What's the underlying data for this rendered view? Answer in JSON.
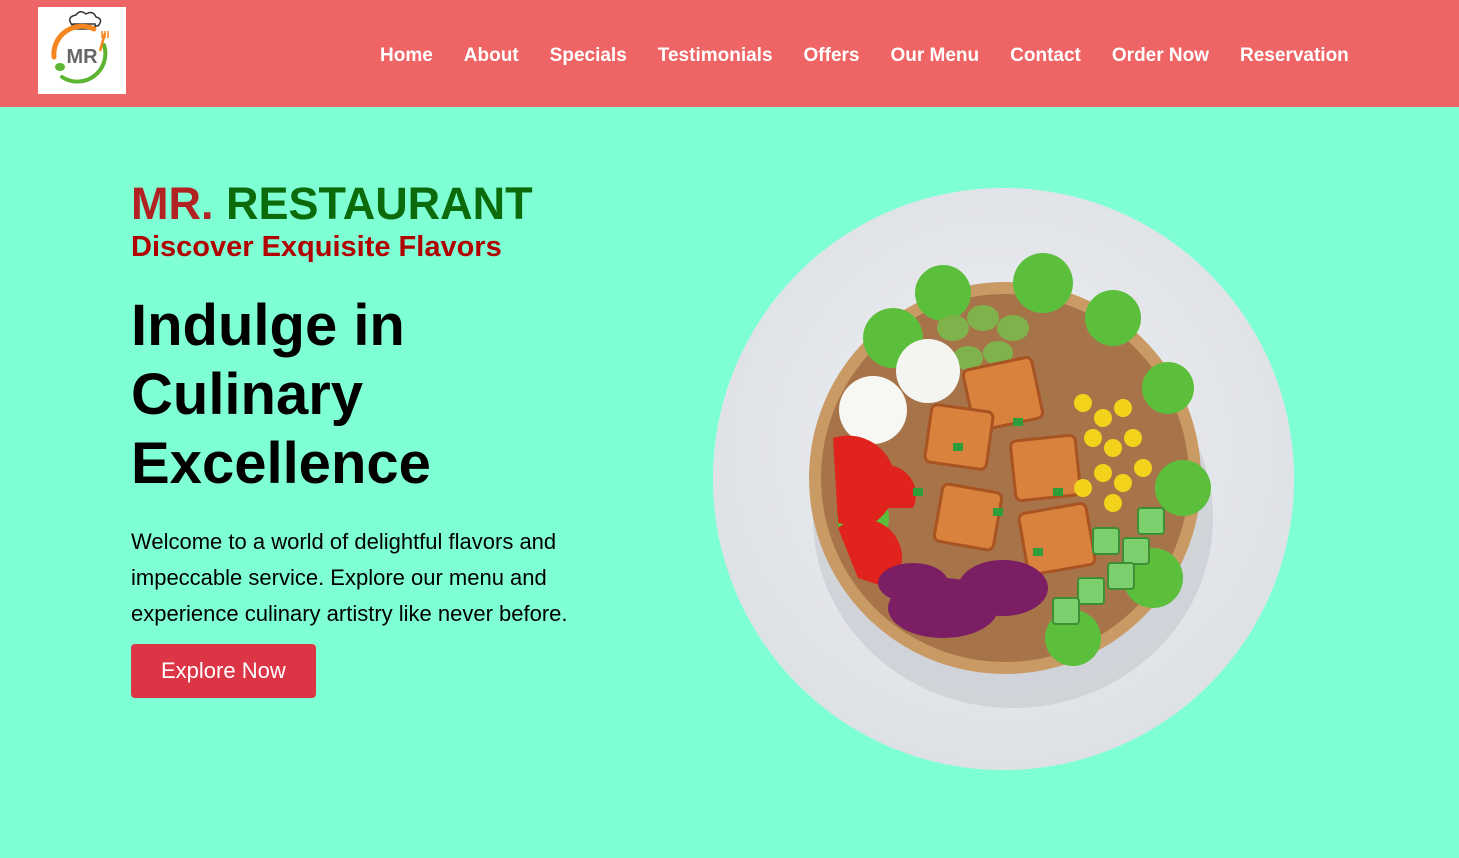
{
  "brand": {
    "logo_text": "MR",
    "logo_alt": "MR Restaurant logo"
  },
  "nav": {
    "items": [
      {
        "label": "Home"
      },
      {
        "label": "About"
      },
      {
        "label": "Specials"
      },
      {
        "label": "Testimonials"
      },
      {
        "label": "Offers"
      },
      {
        "label": "Our Menu"
      },
      {
        "label": "Contact"
      },
      {
        "label": "Order Now"
      },
      {
        "label": "Reservation"
      }
    ]
  },
  "hero": {
    "brand_first": "MR.",
    "brand_second": "RESTAURANT",
    "tagline": "Discover Exquisite Flavors",
    "headline": "Indulge in Culinary Excellence",
    "description": "Welcome to a world of delightful flavors and impeccable service. Explore our menu and experience culinary artistry like never before.",
    "cta_label": "Explore Now",
    "image_icon": "salad-bowl-photo"
  },
  "colors": {
    "navbar_bg": "#ef6464",
    "page_bg": "#7fffd4",
    "brand_red": "#b22222",
    "brand_green": "#0b6b0b",
    "tagline": "#b00000",
    "cta_bg": "#dc3545"
  }
}
